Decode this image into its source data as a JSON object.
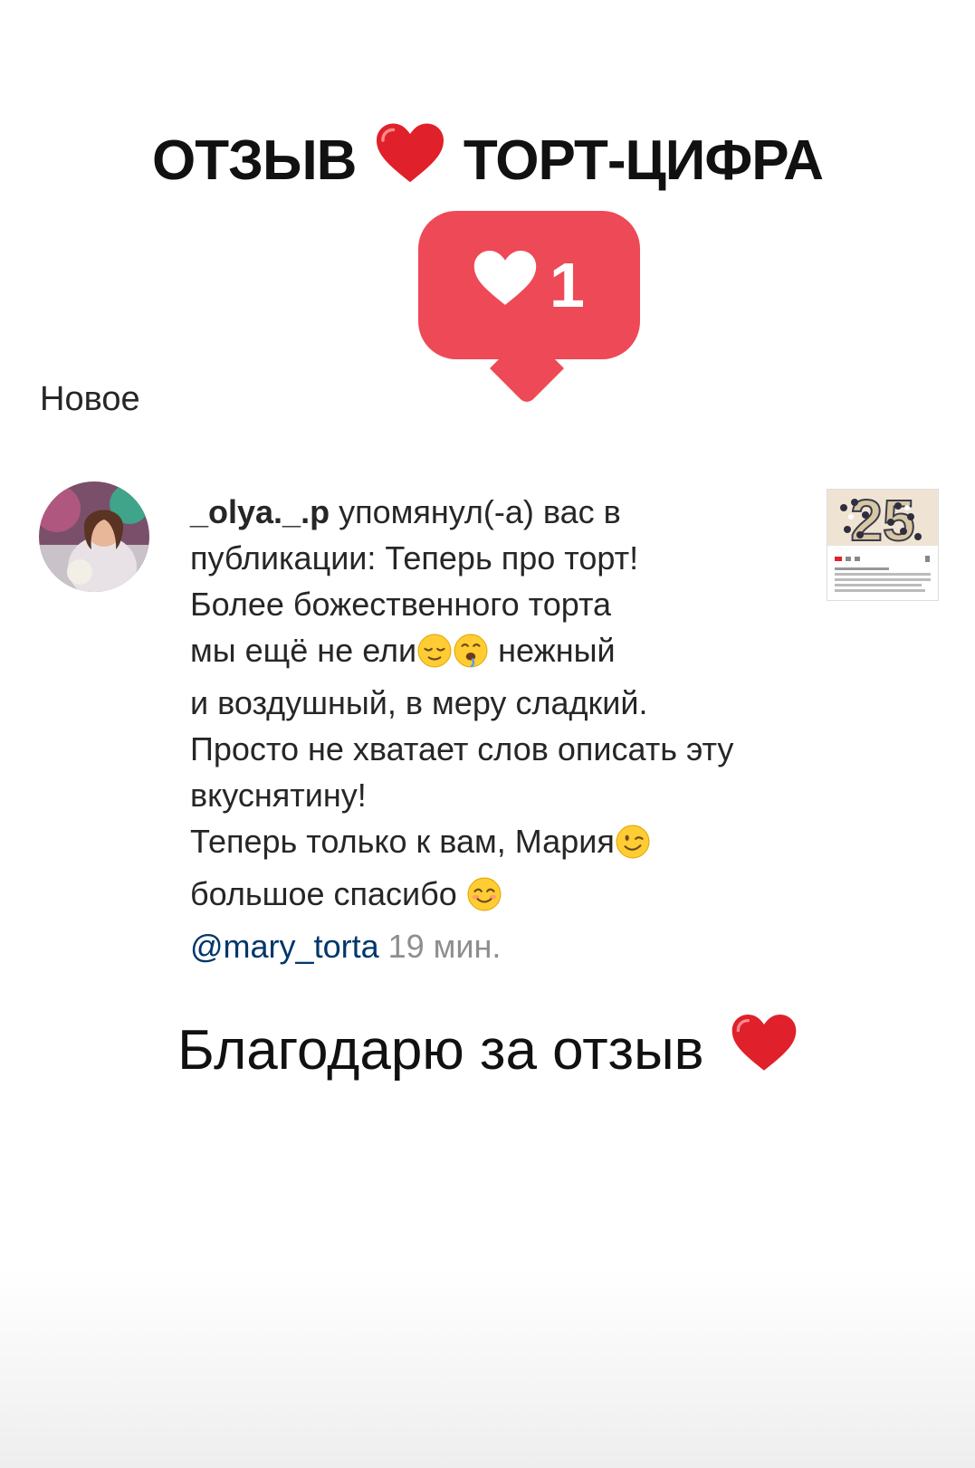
{
  "title": {
    "left": "ОТЗЫВ",
    "right": "ТОРТ-ЦИФРА",
    "heart_icon": "red-heart-icon"
  },
  "like_badge": {
    "count": "1",
    "icon": "white-heart-icon",
    "color": "#ee4956"
  },
  "section": {
    "label": "Новое"
  },
  "notification": {
    "username": "_olya._.p",
    "lines": [
      " упомянул(-а) вас в",
      "публикации: Теперь про торт!",
      "Более божественного торта",
      "мы ещё не ели",
      " нежный",
      "и воздушный, в меру сладкий.",
      "Просто не хватает слов описать эту",
      "вкуснятину!",
      "Теперь только к вам, Мария",
      "большое спасибо "
    ],
    "mention": "@mary_torta",
    "time": "19 мин.",
    "emojis": [
      "relieved-face-icon",
      "drooling-face-icon",
      "winking-face-icon",
      "smiling-face-icon"
    ]
  },
  "thumbnail": {
    "label": "25"
  },
  "footer": {
    "text": "Благодарю за отзыв",
    "heart_icon": "red-heart-icon"
  },
  "colors": {
    "badge": "#ee4956",
    "heart": "#e0202a",
    "mention": "#00376b",
    "muted": "#8e8e8e"
  }
}
